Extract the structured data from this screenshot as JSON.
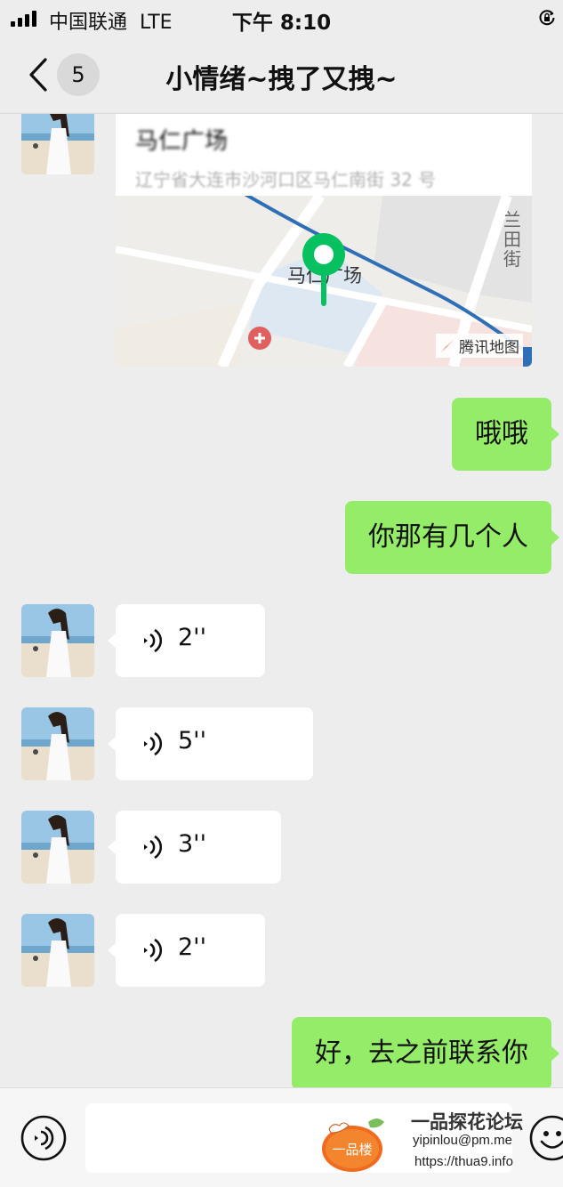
{
  "status_bar": {
    "carrier": "中国联通",
    "network": "LTE",
    "time": "下午 8:10"
  },
  "nav": {
    "unread_count": "5",
    "title": "小情绪~拽了又拽~"
  },
  "messages": {
    "location": {
      "name": "马仁广场",
      "address": "辽宁省大连市沙河口区马仁南街 32 号",
      "map_label": "马仁广场",
      "road_label": "兰田街",
      "map_provider": "腾讯地图"
    },
    "outgoing": [
      "哦哦",
      "你那有几个人",
      "好，去之前联系你"
    ],
    "voice": [
      "2''",
      "5''",
      "3''",
      "2''"
    ]
  },
  "input_bar": {
    "placeholder": ""
  },
  "watermark": {
    "logo_text": "一品楼",
    "name": "一品探花论坛",
    "email": "yipinlou@pm.me",
    "url": "https://thua9.info"
  },
  "colors": {
    "outgoing_bubble": "#95ec69",
    "background": "#ededed",
    "map_pin": "#07c160"
  }
}
